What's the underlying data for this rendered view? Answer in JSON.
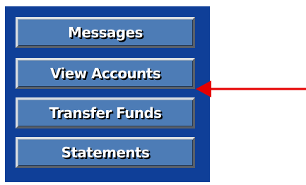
{
  "menu": {
    "items": [
      {
        "label": "Messages"
      },
      {
        "label": "View Accounts"
      },
      {
        "label": "Transfer Funds"
      },
      {
        "label": "Statements"
      }
    ],
    "highlighted_index": 1
  },
  "colors": {
    "panel": "#0f3f98",
    "button": "#4d7cb6",
    "button_text": "#ffffff",
    "arrow": "#e60000"
  },
  "icons": {
    "pointer": "red-arrow-icon"
  }
}
